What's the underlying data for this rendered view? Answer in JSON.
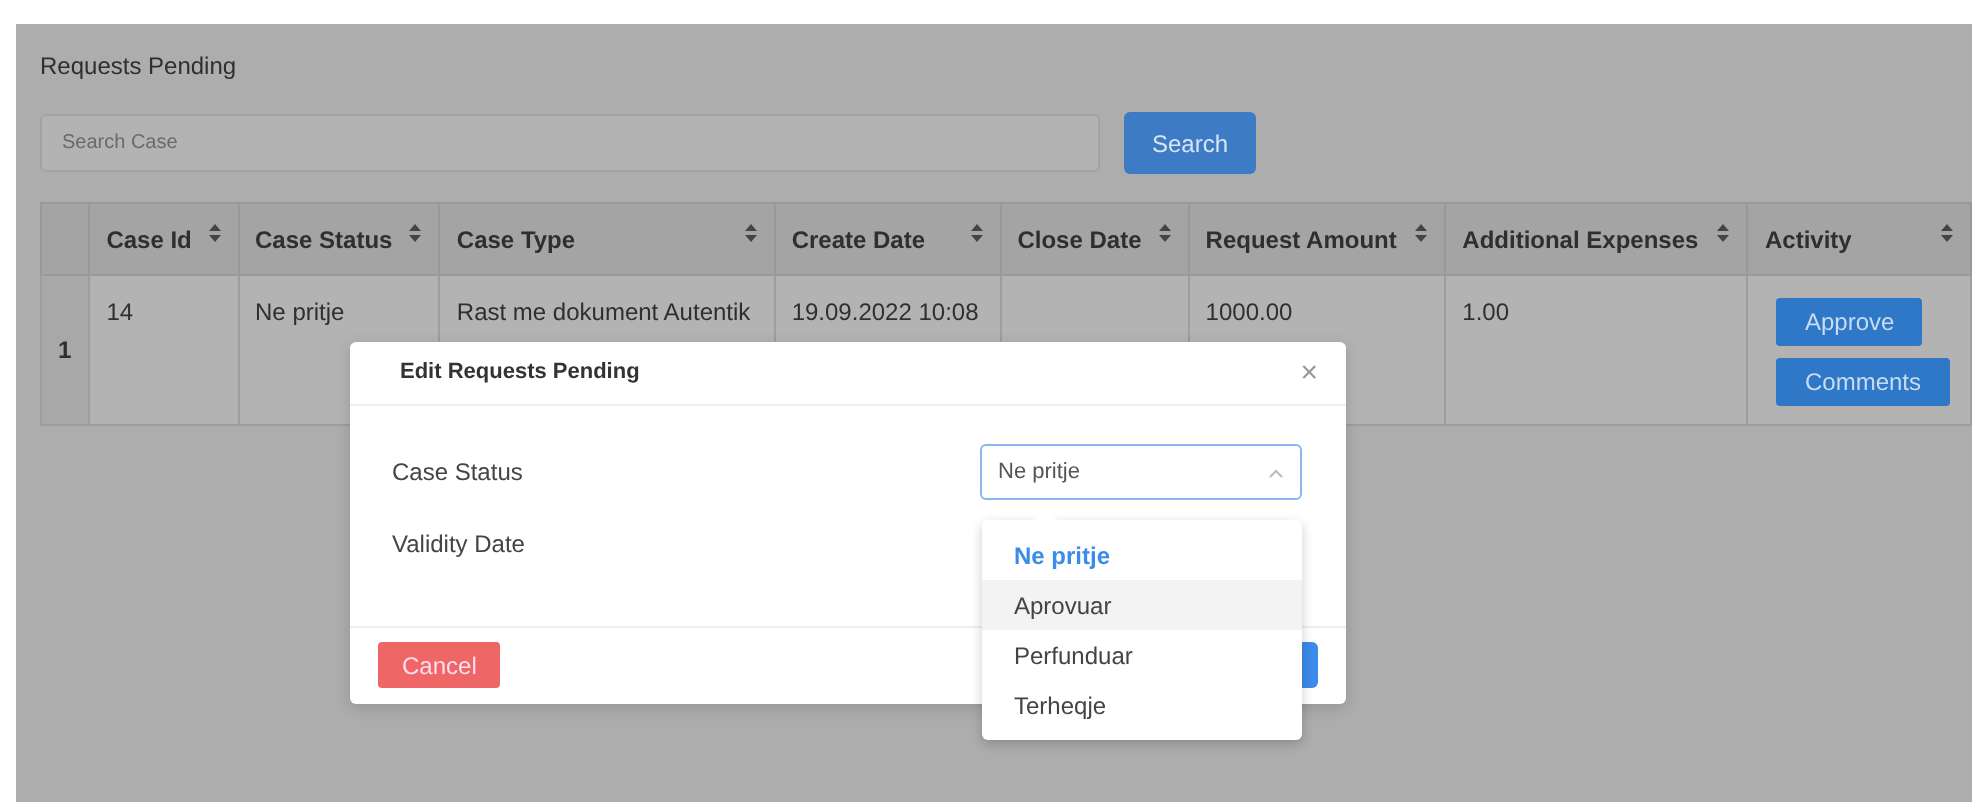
{
  "page": {
    "title": "Requests Pending"
  },
  "search": {
    "placeholder": "Search Case",
    "button": "Search"
  },
  "table": {
    "columns": [
      {
        "label": "Case Id"
      },
      {
        "label": "Case Status"
      },
      {
        "label": "Case Type"
      },
      {
        "label": "Create Date"
      },
      {
        "label": "Close Date"
      },
      {
        "label": "Request Amount"
      },
      {
        "label": "Additional Expenses"
      },
      {
        "label": "Activity"
      }
    ],
    "rows": [
      {
        "number": "1",
        "cells": [
          "14",
          "Ne pritje",
          "Rast me dokument Autentik",
          "19.09.2022 10:08",
          "",
          "1000.00",
          "1.00"
        ],
        "actions": [
          "Approve",
          "Comments"
        ]
      }
    ]
  },
  "modal": {
    "title": "Edit Requests Pending",
    "close": "×",
    "fields": [
      {
        "label": "Case Status",
        "kind": "select",
        "value": "Ne pritje",
        "expanded": true
      },
      {
        "label": "Validity Date",
        "kind": "date"
      }
    ],
    "options": [
      {
        "label": "Ne pritje",
        "selected": true,
        "hovered": false
      },
      {
        "label": "Aprovuar",
        "selected": false,
        "hovered": true
      },
      {
        "label": "Perfunduar",
        "selected": false,
        "hovered": false
      },
      {
        "label": "Terheqje",
        "selected": false,
        "hovered": false
      }
    ],
    "buttons": [
      {
        "label": "Cancel",
        "kind": "danger"
      },
      {
        "kind": "primary"
      }
    ]
  }
}
